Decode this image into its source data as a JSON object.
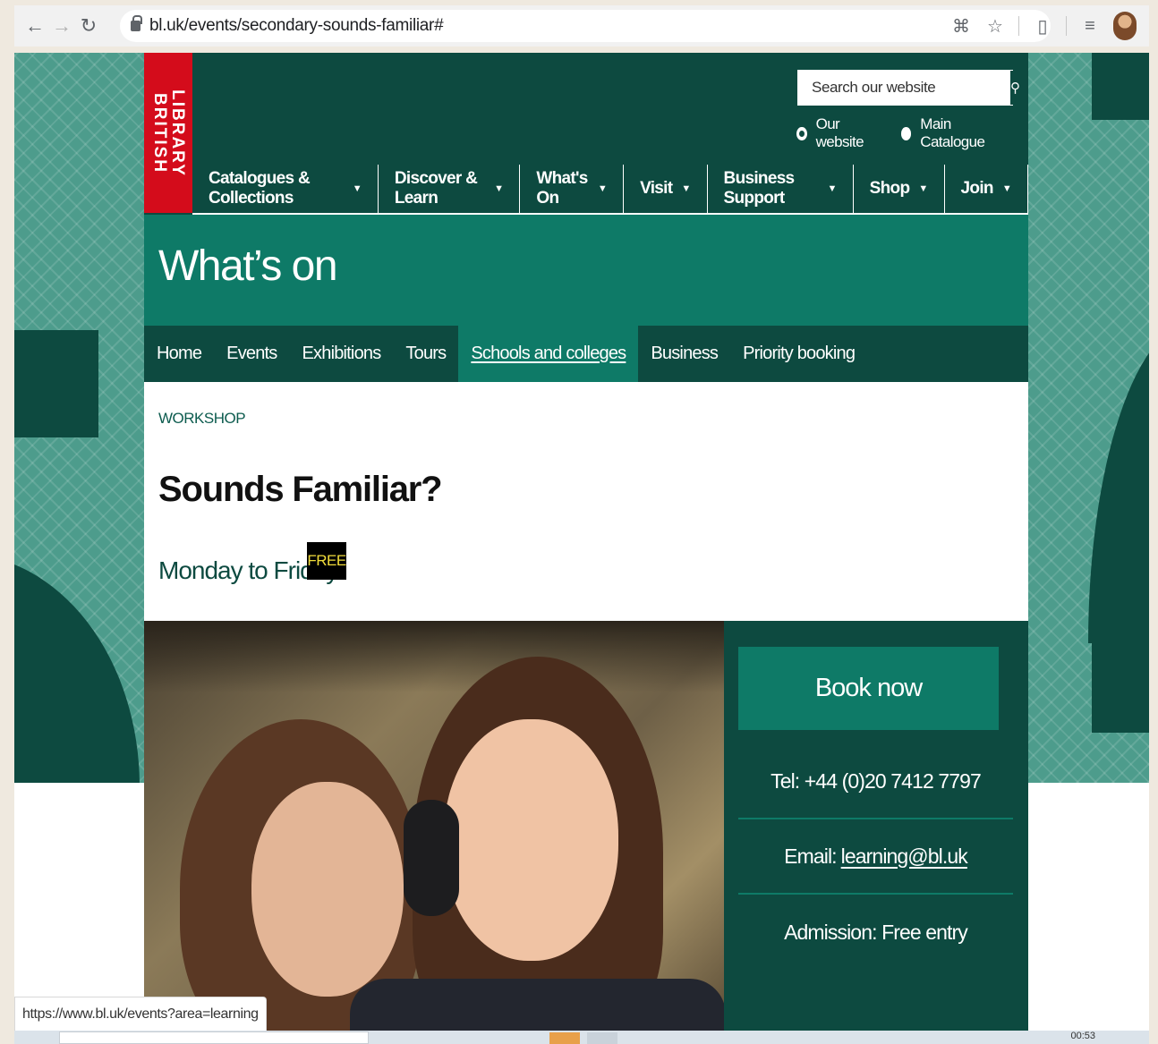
{
  "browser": {
    "url": "bl.uk/events/secondary-sounds-familiar#",
    "icons": [
      "back-icon",
      "forward-icon",
      "reload-icon",
      "lock-icon",
      "translate-icon",
      "star-icon",
      "extension-icon",
      "reading-list-icon",
      "profile-avatar"
    ]
  },
  "header": {
    "logo_line1": "BRITISH",
    "logo_line2": "LIBRARY",
    "search_placeholder": "Search our website",
    "search_icon": "search-icon",
    "radio_our_website": "Our website",
    "radio_main_catalogue": "Main Catalogue",
    "radio_selected": "Our website"
  },
  "mainnav": [
    {
      "label": "Catalogues & Collections",
      "caret": "▼"
    },
    {
      "label": "Discover & Learn",
      "caret": "▼"
    },
    {
      "label": "What's On",
      "caret": "▼"
    },
    {
      "label": "Visit",
      "caret": "▼"
    },
    {
      "label": "Business Support",
      "caret": "▼"
    },
    {
      "label": "Shop",
      "caret": "▼"
    },
    {
      "label": "Join",
      "caret": "▼"
    }
  ],
  "section": {
    "title": "What’s on"
  },
  "subnav": [
    {
      "label": "Home"
    },
    {
      "label": "Events"
    },
    {
      "label": "Exhibitions"
    },
    {
      "label": "Tours"
    },
    {
      "label": "Schools and colleges",
      "active": true
    },
    {
      "label": "Business"
    },
    {
      "label": "Priority booking"
    }
  ],
  "event": {
    "kicker": "WORKSHOP",
    "title": "Sounds Familiar?",
    "dates": "Monday to Friday",
    "price_badge": "FREE"
  },
  "booking": {
    "book_label": "Book now",
    "tel": "Tel: +44 (0)20 7412 7797",
    "email_prefix": "Email:",
    "email": "learning@bl.uk",
    "admission": "Admission: Free entry"
  },
  "status_bar": {
    "link_preview": "https://www.bl.uk/events?area=learning"
  },
  "taskbar": {
    "clock": "00:53"
  },
  "colors": {
    "dark_green": "#0d4a40",
    "teal": "#0e7a67",
    "bl_red": "#d40c1b",
    "free_text": "#f2dd3b"
  }
}
